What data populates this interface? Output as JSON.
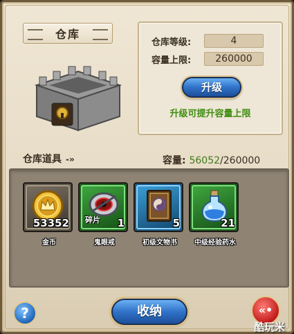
{
  "title": "仓库",
  "info": {
    "level_label": "仓库等级:",
    "level_value": "4",
    "capacity_label": "容量上限:",
    "capacity_value": "260000",
    "upgrade_button": "升级",
    "upgrade_hint": "升级可提升容量上限"
  },
  "storage": {
    "header": "仓库道具",
    "header_arrow": "-»",
    "capacity_label": "容量:",
    "used": "56052",
    "separator": "/",
    "total": "260000"
  },
  "items": [
    {
      "name": "金币",
      "qty": "53352",
      "frame_color": "#6a6256",
      "icon": "gold-coin-icon"
    },
    {
      "name": "鬼眼戒",
      "qty": "1",
      "frame_color": "#2f9a2f",
      "icon": "eye-ring-icon",
      "tag": "碎片"
    },
    {
      "name": "初级文物书",
      "qty": "5",
      "frame_color": "#2a8fc0",
      "icon": "relic-book-icon"
    },
    {
      "name": "中级经验药水",
      "qty": "21",
      "frame_color": "#2f9a2f",
      "icon": "exp-potion-icon"
    }
  ],
  "bottom": {
    "help": "?",
    "collect": "收纳",
    "back": "«•",
    "watermark": "酷玩米"
  },
  "colors": {
    "accent_blue": "#2f72c8",
    "hint_green": "#3f8d12",
    "used_green": "#3f7a1a"
  }
}
